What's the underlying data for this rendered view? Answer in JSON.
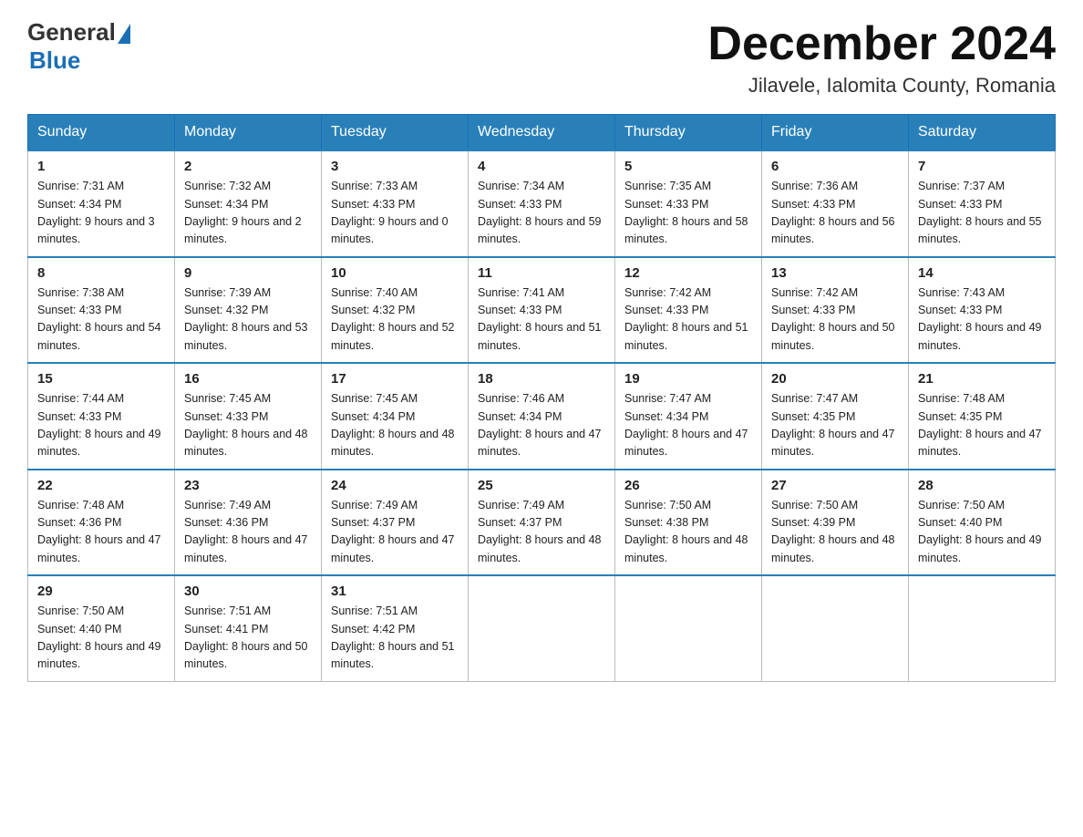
{
  "header": {
    "logo_general": "General",
    "logo_blue": "Blue",
    "month_title": "December 2024",
    "location": "Jilavele, Ialomita County, Romania"
  },
  "calendar": {
    "days_of_week": [
      "Sunday",
      "Monday",
      "Tuesday",
      "Wednesday",
      "Thursday",
      "Friday",
      "Saturday"
    ],
    "weeks": [
      [
        {
          "day": "1",
          "sunrise": "7:31 AM",
          "sunset": "4:34 PM",
          "daylight": "9 hours and 3 minutes."
        },
        {
          "day": "2",
          "sunrise": "7:32 AM",
          "sunset": "4:34 PM",
          "daylight": "9 hours and 2 minutes."
        },
        {
          "day": "3",
          "sunrise": "7:33 AM",
          "sunset": "4:33 PM",
          "daylight": "9 hours and 0 minutes."
        },
        {
          "day": "4",
          "sunrise": "7:34 AM",
          "sunset": "4:33 PM",
          "daylight": "8 hours and 59 minutes."
        },
        {
          "day": "5",
          "sunrise": "7:35 AM",
          "sunset": "4:33 PM",
          "daylight": "8 hours and 58 minutes."
        },
        {
          "day": "6",
          "sunrise": "7:36 AM",
          "sunset": "4:33 PM",
          "daylight": "8 hours and 56 minutes."
        },
        {
          "day": "7",
          "sunrise": "7:37 AM",
          "sunset": "4:33 PM",
          "daylight": "8 hours and 55 minutes."
        }
      ],
      [
        {
          "day": "8",
          "sunrise": "7:38 AM",
          "sunset": "4:33 PM",
          "daylight": "8 hours and 54 minutes."
        },
        {
          "day": "9",
          "sunrise": "7:39 AM",
          "sunset": "4:32 PM",
          "daylight": "8 hours and 53 minutes."
        },
        {
          "day": "10",
          "sunrise": "7:40 AM",
          "sunset": "4:32 PM",
          "daylight": "8 hours and 52 minutes."
        },
        {
          "day": "11",
          "sunrise": "7:41 AM",
          "sunset": "4:33 PM",
          "daylight": "8 hours and 51 minutes."
        },
        {
          "day": "12",
          "sunrise": "7:42 AM",
          "sunset": "4:33 PM",
          "daylight": "8 hours and 51 minutes."
        },
        {
          "day": "13",
          "sunrise": "7:42 AM",
          "sunset": "4:33 PM",
          "daylight": "8 hours and 50 minutes."
        },
        {
          "day": "14",
          "sunrise": "7:43 AM",
          "sunset": "4:33 PM",
          "daylight": "8 hours and 49 minutes."
        }
      ],
      [
        {
          "day": "15",
          "sunrise": "7:44 AM",
          "sunset": "4:33 PM",
          "daylight": "8 hours and 49 minutes."
        },
        {
          "day": "16",
          "sunrise": "7:45 AM",
          "sunset": "4:33 PM",
          "daylight": "8 hours and 48 minutes."
        },
        {
          "day": "17",
          "sunrise": "7:45 AM",
          "sunset": "4:34 PM",
          "daylight": "8 hours and 48 minutes."
        },
        {
          "day": "18",
          "sunrise": "7:46 AM",
          "sunset": "4:34 PM",
          "daylight": "8 hours and 47 minutes."
        },
        {
          "day": "19",
          "sunrise": "7:47 AM",
          "sunset": "4:34 PM",
          "daylight": "8 hours and 47 minutes."
        },
        {
          "day": "20",
          "sunrise": "7:47 AM",
          "sunset": "4:35 PM",
          "daylight": "8 hours and 47 minutes."
        },
        {
          "day": "21",
          "sunrise": "7:48 AM",
          "sunset": "4:35 PM",
          "daylight": "8 hours and 47 minutes."
        }
      ],
      [
        {
          "day": "22",
          "sunrise": "7:48 AM",
          "sunset": "4:36 PM",
          "daylight": "8 hours and 47 minutes."
        },
        {
          "day": "23",
          "sunrise": "7:49 AM",
          "sunset": "4:36 PM",
          "daylight": "8 hours and 47 minutes."
        },
        {
          "day": "24",
          "sunrise": "7:49 AM",
          "sunset": "4:37 PM",
          "daylight": "8 hours and 47 minutes."
        },
        {
          "day": "25",
          "sunrise": "7:49 AM",
          "sunset": "4:37 PM",
          "daylight": "8 hours and 48 minutes."
        },
        {
          "day": "26",
          "sunrise": "7:50 AM",
          "sunset": "4:38 PM",
          "daylight": "8 hours and 48 minutes."
        },
        {
          "day": "27",
          "sunrise": "7:50 AM",
          "sunset": "4:39 PM",
          "daylight": "8 hours and 48 minutes."
        },
        {
          "day": "28",
          "sunrise": "7:50 AM",
          "sunset": "4:40 PM",
          "daylight": "8 hours and 49 minutes."
        }
      ],
      [
        {
          "day": "29",
          "sunrise": "7:50 AM",
          "sunset": "4:40 PM",
          "daylight": "8 hours and 49 minutes."
        },
        {
          "day": "30",
          "sunrise": "7:51 AM",
          "sunset": "4:41 PM",
          "daylight": "8 hours and 50 minutes."
        },
        {
          "day": "31",
          "sunrise": "7:51 AM",
          "sunset": "4:42 PM",
          "daylight": "8 hours and 51 minutes."
        },
        null,
        null,
        null,
        null
      ]
    ]
  }
}
